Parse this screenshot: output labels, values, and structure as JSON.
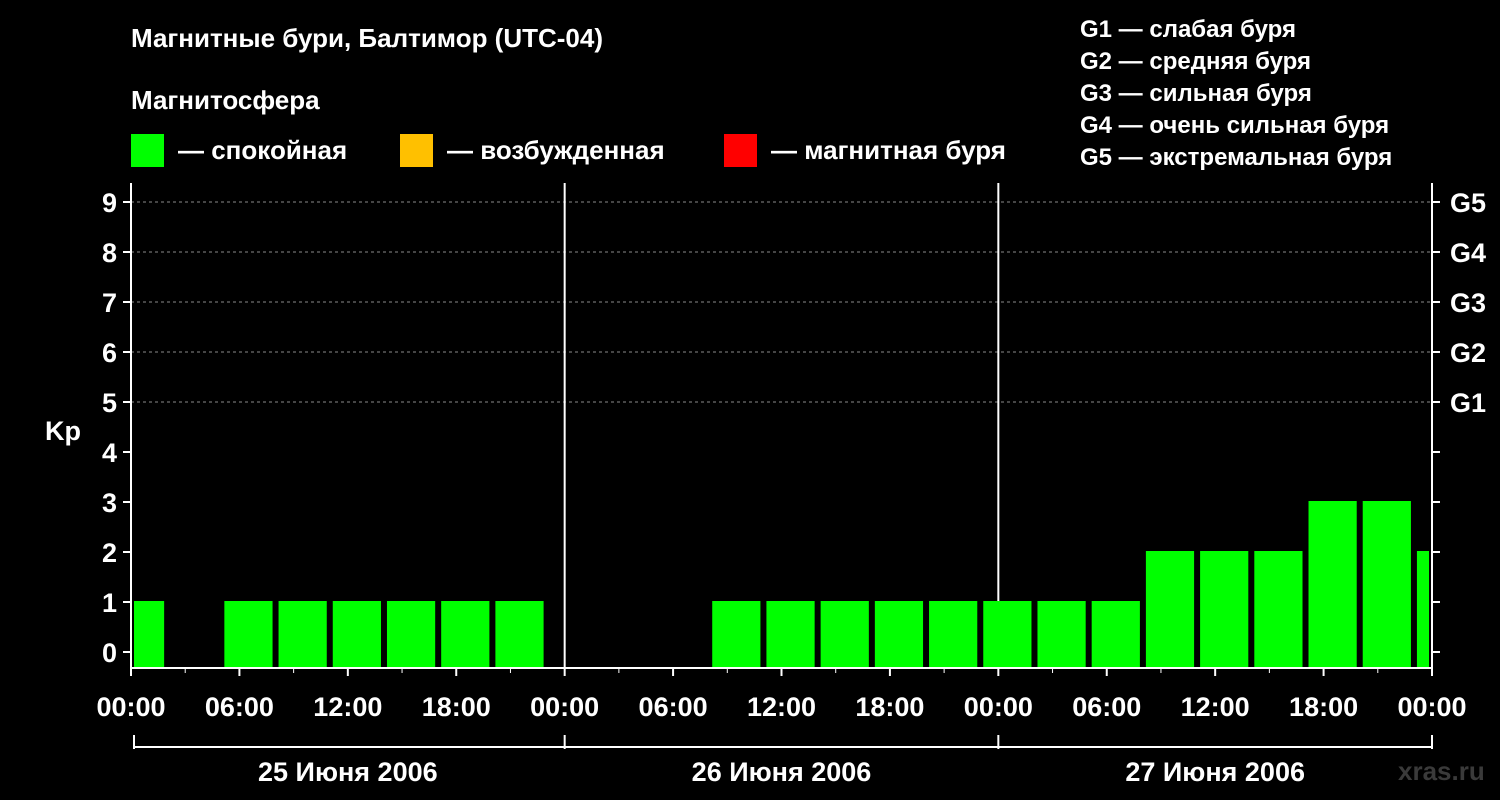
{
  "header": {
    "title": "Магнитные бури, Балтимор (UTC-04)",
    "subtitle": "Магнитосфера"
  },
  "legend": [
    {
      "label": "— спокойная",
      "color": "#00ff00"
    },
    {
      "label": "— возбужденная",
      "color": "#ffc000"
    },
    {
      "label": "— магнитная буря",
      "color": "#ff0000"
    }
  ],
  "storm_scale": [
    "G1 — слабая буря",
    "G2 — средняя буря",
    "G3 — сильная буря",
    "G4 — очень сильная буря",
    "G5 — экстремальная буря"
  ],
  "watermark": "xras.ru",
  "chart_data": {
    "type": "bar",
    "ylabel": "Kp",
    "ylim": [
      0,
      9
    ],
    "yticks": [
      "0",
      "1",
      "2",
      "3",
      "4",
      "5",
      "6",
      "7",
      "8",
      "9"
    ],
    "right_axis_labels": [
      {
        "kp": 5,
        "label": "G1"
      },
      {
        "kp": 6,
        "label": "G2"
      },
      {
        "kp": 7,
        "label": "G3"
      },
      {
        "kp": 8,
        "label": "G4"
      },
      {
        "kp": 9,
        "label": "G5"
      }
    ],
    "xticks": [
      "00:00",
      "06:00",
      "12:00",
      "18:00",
      "00:00",
      "06:00",
      "12:00",
      "18:00",
      "00:00",
      "06:00",
      "12:00",
      "18:00",
      "00:00"
    ],
    "days": [
      "25 Июня 2006",
      "26 Июня 2006",
      "27 Июня 2006"
    ],
    "grid": "dashed horizontal at Kp 5–9",
    "bar_color": "#00ff00",
    "bars": [
      {
        "start": "25 Июня 2006 00:00",
        "end": "25 Июня 2006 02:00",
        "kp": 1
      },
      {
        "start": "25 Июня 2006 05:00",
        "end": "25 Июня 2006 08:00",
        "kp": 1
      },
      {
        "start": "25 Июня 2006 08:00",
        "end": "25 Июня 2006 11:00",
        "kp": 1
      },
      {
        "start": "25 Июня 2006 11:00",
        "end": "25 Июня 2006 14:00",
        "kp": 1
      },
      {
        "start": "25 Июня 2006 14:00",
        "end": "25 Июня 2006 17:00",
        "kp": 1
      },
      {
        "start": "25 Июня 2006 17:00",
        "end": "25 Июня 2006 20:00",
        "kp": 1
      },
      {
        "start": "25 Июня 2006 20:00",
        "end": "25 Июня 2006 23:00",
        "kp": 1
      },
      {
        "start": "26 Июня 2006 08:00",
        "end": "26 Июня 2006 11:00",
        "kp": 1
      },
      {
        "start": "26 Июня 2006 11:00",
        "end": "26 Июня 2006 14:00",
        "kp": 1
      },
      {
        "start": "26 Июня 2006 14:00",
        "end": "26 Июня 2006 17:00",
        "kp": 1
      },
      {
        "start": "26 Июня 2006 17:00",
        "end": "26 Июня 2006 20:00",
        "kp": 1
      },
      {
        "start": "26 Июня 2006 20:00",
        "end": "26 Июня 2006 23:00",
        "kp": 1
      },
      {
        "start": "26 Июня 2006 23:00",
        "end": "27 Июня 2006 02:00",
        "kp": 1
      },
      {
        "start": "27 Июня 2006 02:00",
        "end": "27 Июня 2006 05:00",
        "kp": 1
      },
      {
        "start": "27 Июня 2006 05:00",
        "end": "27 Июня 2006 08:00",
        "kp": 1
      },
      {
        "start": "27 Июня 2006 08:00",
        "end": "27 Июня 2006 11:00",
        "kp": 2
      },
      {
        "start": "27 Июня 2006 11:00",
        "end": "27 Июня 2006 14:00",
        "kp": 2
      },
      {
        "start": "27 Июня 2006 14:00",
        "end": "27 Июня 2006 17:00",
        "kp": 2
      },
      {
        "start": "27 Июня 2006 17:00",
        "end": "27 Июня 2006 20:00",
        "kp": 3
      },
      {
        "start": "27 Июня 2006 20:00",
        "end": "27 Июня 2006 23:00",
        "kp": 3
      },
      {
        "start": "27 Июня 2006 23:00",
        "end": "28 Июня 2006 00:00",
        "kp": 2
      }
    ]
  }
}
